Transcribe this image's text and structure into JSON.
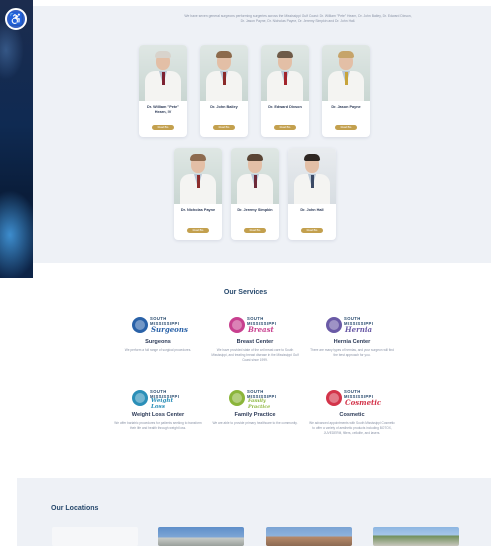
{
  "colors": {
    "navy_heading": "#27496d",
    "gold_button": "#c3a04e",
    "section_bg": "#eef1f6",
    "accessibility_blue": "#3461c7"
  },
  "accessibility": {
    "icon": "accessibility-icon",
    "glyph": "♿"
  },
  "team": {
    "intro": "We have seven general surgeons performing surgeries across the Mississippi Gulf Coast: Dr. William \"Pete\" Hearn, Dr. John Bailey, Dr. Edward Dixson, Dr. Jason Payne, Dr. Nicholas Payne, Dr. Jeremy Simpkin and Dr. John Hall.",
    "doctors": [
      {
        "name": "Dr. William \"Pete\" Hearn, IV",
        "button": "Read Bio"
      },
      {
        "name": "Dr. John Bailey",
        "button": "Read Bio"
      },
      {
        "name": "Dr. Edward Dixson",
        "button": "Read Bio"
      },
      {
        "name": "Dr. Jason Payne",
        "button": "Read Bio"
      },
      {
        "name": "Dr. Nicholas Payne",
        "button": "Read Bio"
      },
      {
        "name": "Dr. Jeremy Simpkin",
        "button": "Read Bio"
      },
      {
        "name": "Dr. John Hall",
        "button": "Read Bio"
      }
    ]
  },
  "services": {
    "title": "Our Services",
    "items": [
      {
        "title": "Surgeons",
        "brand": "SOUTH MISSISSIPPI",
        "script": "Surgeons",
        "color": "#2a62a8",
        "description": "We perform a full range of surgical procedures."
      },
      {
        "title": "Breast Center",
        "brand": "SOUTH MISSISSIPPI",
        "script": "Breast",
        "color": "#c8408f",
        "description": "We have provided state of the art breast care to South Mississippi, and treating breast disease in the Mississippi Gulf Coast since 1999."
      },
      {
        "title": "Hernia Center",
        "brand": "SOUTH MISSISSIPPI",
        "script": "Hernia",
        "color": "#6a5aa6",
        "description": "There are many types of hernias, and your surgeon will find the best approach for you."
      },
      {
        "title": "Weight Loss Center",
        "brand": "SOUTH MISSISSIPPI",
        "script": "Weight Loss",
        "color": "#2b8fb8",
        "description": "We offer bariatric procedures for patients seeking to transform their life and health through weight loss."
      },
      {
        "title": "Family Practice",
        "brand": "SOUTH MISSISSIPPI",
        "script": "Family Practice",
        "color": "#8bb53a",
        "description": "We are able to provide primary healthcare to the community."
      },
      {
        "title": "Cosmetic",
        "brand": "SOUTH MISSISSIPPI",
        "script": "Cosmetic",
        "color": "#d3344a",
        "description": "We advanced appointments with South Mississippi Cosmetic to offer a variety of aesthetic products including BOTOX, JUVEDERM, fillers, cellulite, and lasers."
      }
    ]
  },
  "locations": {
    "title": "Our Locations"
  }
}
